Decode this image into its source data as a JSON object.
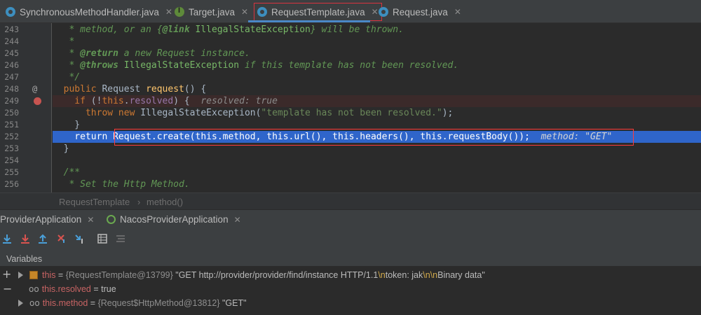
{
  "tabs": [
    {
      "label": "SynchronousMethodHandler.java",
      "icon": "class-icon"
    },
    {
      "label": "Target.java",
      "icon": "interface-icon"
    },
    {
      "label": "RequestTemplate.java",
      "icon": "class-icon",
      "active": true
    },
    {
      "label": "Request.java",
      "icon": "class-icon"
    }
  ],
  "editor": {
    "line_numbers": [
      "243",
      "244",
      "245",
      "246",
      "247",
      "248",
      "249",
      "250",
      "251",
      "252",
      "253",
      "254",
      "255",
      "256"
    ],
    "lines": {
      "l243": {
        "p1": "   * method, or an {",
        "tag": "@link",
        "link": " IllegalStateException",
        "p2": "} will be thrown."
      },
      "l244": {
        "p1": "   *"
      },
      "l245": {
        "p1": "   * ",
        "tag": "@return",
        "p2": " a new Request instance."
      },
      "l246": {
        "p1": "   * ",
        "tag": "@throws",
        "link": " IllegalStateException",
        "p2": " if this template has not been resolved."
      },
      "l247": {
        "p1": "   */"
      },
      "l248": {
        "kw": "  public",
        "typ": " Request",
        "fn": " request",
        "p2": "() {"
      },
      "l249": {
        "kw": "    if",
        "p1": " (!",
        "kw2": "this",
        "p2": ".",
        "fld": "resolved",
        "p3": ") {  ",
        "hint": "resolved: true"
      },
      "l250": {
        "kw": "      throw new",
        "typ": " IllegalStateException",
        "p1": "(",
        "str": "\"template has not been resolved.\"",
        "p2": ");"
      },
      "l251": {
        "p1": "    }"
      },
      "l252": {
        "kw": "    return",
        "code": " Request.create(this.method, this.url(), this.headers(), this.requestBody());",
        "hint": "  method: \"GET\""
      },
      "l253": {
        "p1": "  }"
      },
      "l254": {
        "p1": ""
      },
      "l255": {
        "p1": "  /**"
      },
      "l256": {
        "p1": "   * Set the Http Method."
      }
    }
  },
  "breadcrumb": {
    "class": "RequestTemplate",
    "separator": "›",
    "method": "method()"
  },
  "debug": {
    "run_tabs": [
      {
        "label": "ProviderApplication"
      },
      {
        "label": "NacosProviderApplication"
      }
    ],
    "variables_label": "Variables",
    "variables": [
      {
        "name": "this",
        "eq": " = ",
        "ref": "{RequestTemplate@13799}",
        "value": " \"GET http://provider/provider/find/instance HTTP/1.1",
        "nl1": "\\n",
        "value2": "token: jak",
        "nl2": "\\n\\n",
        "value3": "Binary data\""
      },
      {
        "name": "this.resolved",
        "eq": " = ",
        "value": "true"
      },
      {
        "name": "this.method",
        "eq": " = ",
        "ref": "{Request$HttpMethod@13812}",
        "value": " \"GET\""
      }
    ]
  },
  "colors": {
    "accent": "#2f65ca",
    "highlight_border": "#ff3b3b",
    "keyword": "#cc7832",
    "string": "#6a8759"
  }
}
